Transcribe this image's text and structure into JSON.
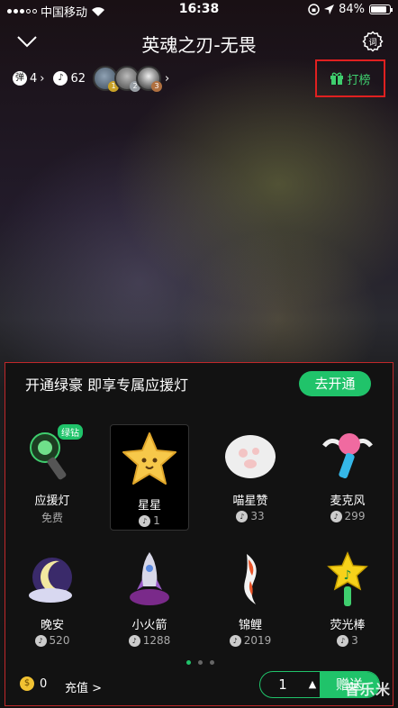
{
  "status_bar": {
    "carrier": "中国移动",
    "time": "16:38",
    "battery": "84%",
    "battery_level": 0.84
  },
  "header": {
    "title": "英魂之刃-无畏"
  },
  "stats": {
    "danmaku_count": "4",
    "coin_count": "62",
    "avatar_ranks": [
      "1",
      "2",
      "3"
    ]
  },
  "rank_button": {
    "label": "打榜"
  },
  "panel": {
    "promo_text": "开通绿豪 即享专属应援灯",
    "open_button": "去开通",
    "gifts": [
      {
        "name": "应援灯",
        "price": "免费",
        "badge": "绿钻",
        "icon": "light-stick-icon"
      },
      {
        "name": "星星",
        "price": "1",
        "icon": "star-icon"
      },
      {
        "name": "喵星赞",
        "price": "33",
        "icon": "cat-paw-icon"
      },
      {
        "name": "麦克风",
        "price": "299",
        "icon": "microphone-icon"
      },
      {
        "name": "晚安",
        "price": "520",
        "icon": "moon-icon"
      },
      {
        "name": "小火箭",
        "price": "1288",
        "icon": "rocket-icon"
      },
      {
        "name": "锦鲤",
        "price": "2019",
        "icon": "koi-icon"
      },
      {
        "name": "荧光棒",
        "price": "3",
        "icon": "glow-stick-icon"
      }
    ],
    "page_count": 3,
    "current_page": 1,
    "balance": "0",
    "recharge": "充值 >",
    "quantity": "1",
    "send": "赠送"
  },
  "watermark": "音乐米",
  "colors": {
    "accent": "#20c36a",
    "highlight_border": "#e02020"
  }
}
